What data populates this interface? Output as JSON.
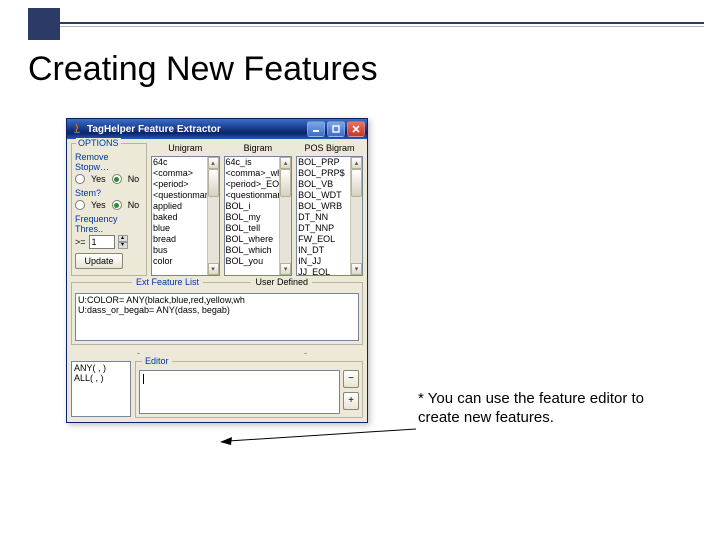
{
  "slide": {
    "title": "Creating New Features",
    "caption": "* You can use the feature editor to create new features."
  },
  "window": {
    "title": "TagHelper Feature Extractor",
    "buttons": {
      "minimize": "–",
      "maximize": "□",
      "close": "×"
    }
  },
  "options": {
    "group_title": "OPTIONS",
    "remove_stopw_label": "Remove Stopw…",
    "stem_label": "Stem?",
    "yes": "Yes",
    "no": "No",
    "freq_label": "Frequency Thres..",
    "freq_op": ">=",
    "freq_value": "1",
    "update_label": "Update"
  },
  "columns": {
    "unigram": {
      "title": "Unigram",
      "items": [
        "64c",
        "<comma>",
        "<period>",
        "<questionmark>",
        "applied",
        "baked",
        "blue",
        "bread",
        "bus",
        "color"
      ]
    },
    "bigram": {
      "title": "Bigram",
      "items": [
        "64c_is",
        "<comma>_whic",
        "<period>_EOL",
        "<questionmark>",
        "BOL_i",
        "BOL_my",
        "BOL_tell",
        "BOL_where",
        "BOL_which",
        "BOL_you"
      ]
    },
    "posbigram": {
      "title": "POS Bigram",
      "items": [
        "BOL_PRP",
        "BOL_PRP$",
        "BOL_VB",
        "BOL_WDT",
        "BOL_WRB",
        "DT_NN",
        "DT_NNP",
        "FW_EOL",
        "IN_DT",
        "IN_JJ",
        "JJ_EOL"
      ]
    }
  },
  "ext": {
    "title": "Ext Feature List",
    "user_defined": "User Defined",
    "items": [
      "U:COLOR= ANY(black,blue,red,yellow,wh",
      "U:dass_or_begab= ANY(dass, begab)"
    ]
  },
  "editor": {
    "functions": [
      "ANY( , )",
      "ALL( , )"
    ],
    "group_title": "Editor",
    "remove": "−",
    "add": "+"
  }
}
